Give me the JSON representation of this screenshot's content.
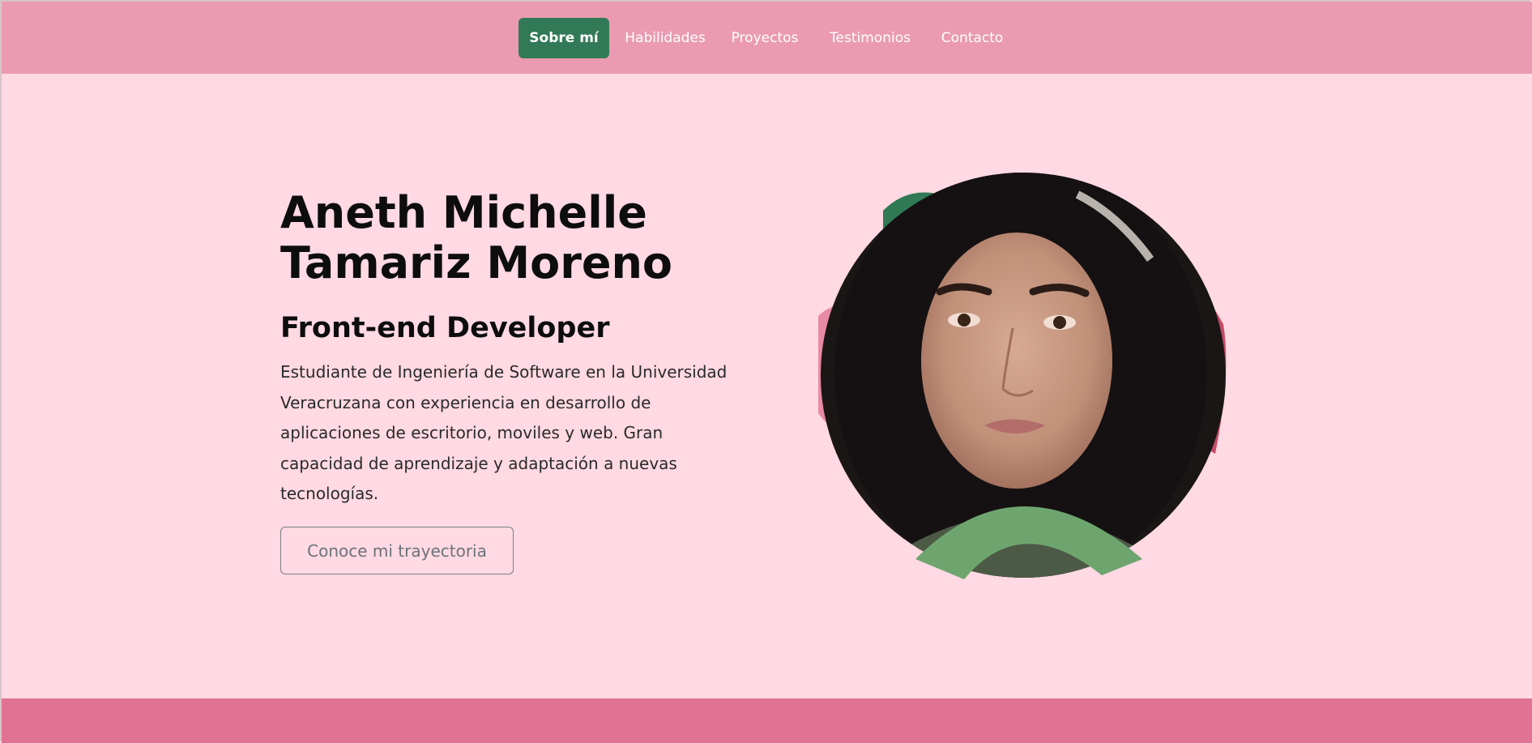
{
  "nav": {
    "items": [
      {
        "label": "Sobre mí",
        "active": true
      },
      {
        "label": "Habilidades",
        "active": false
      },
      {
        "label": "Proyectos",
        "active": false
      },
      {
        "label": "Testimonios",
        "active": false
      },
      {
        "label": "Contacto",
        "active": false
      }
    ]
  },
  "hero": {
    "name_line1": "Aneth Michelle",
    "name_line2": "Tamariz Moreno",
    "role": "Front-end Developer",
    "description": "Estudiante de Ingeniería de Software en la Universidad Veracruzana con experiencia en desarrollo de aplicaciones de escritorio, moviles y web. Gran capacidad de aprendizaje y adaptación a nuevas tecnologías.",
    "button_label": "Conoce mi trayectoria"
  },
  "colors": {
    "page_background": "#ffd9e3",
    "navbar": "#ea9bb1",
    "nav_active": "#327a57",
    "footer": "#e07394",
    "accent_green": "#6ea56f",
    "accent_dark_green": "#2f7a55",
    "accent_crimson": "#c44c68",
    "accent_pink": "#e98aa4"
  },
  "icons": {
    "portrait": "profile-photo"
  }
}
